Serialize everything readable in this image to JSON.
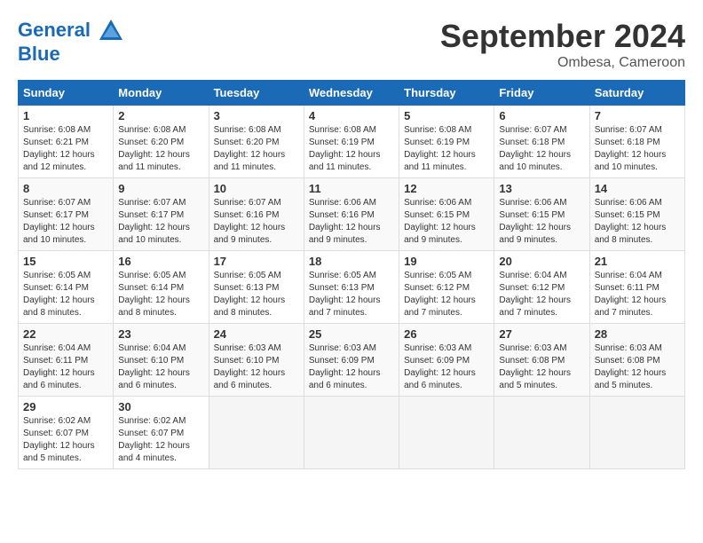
{
  "header": {
    "logo_general": "General",
    "logo_blue": "Blue",
    "month_title": "September 2024",
    "location": "Ombesa, Cameroon"
  },
  "columns": [
    "Sunday",
    "Monday",
    "Tuesday",
    "Wednesday",
    "Thursday",
    "Friday",
    "Saturday"
  ],
  "weeks": [
    [
      {
        "day": "1",
        "info": "Sunrise: 6:08 AM\nSunset: 6:21 PM\nDaylight: 12 hours\nand 12 minutes."
      },
      {
        "day": "2",
        "info": "Sunrise: 6:08 AM\nSunset: 6:20 PM\nDaylight: 12 hours\nand 11 minutes."
      },
      {
        "day": "3",
        "info": "Sunrise: 6:08 AM\nSunset: 6:20 PM\nDaylight: 12 hours\nand 11 minutes."
      },
      {
        "day": "4",
        "info": "Sunrise: 6:08 AM\nSunset: 6:19 PM\nDaylight: 12 hours\nand 11 minutes."
      },
      {
        "day": "5",
        "info": "Sunrise: 6:08 AM\nSunset: 6:19 PM\nDaylight: 12 hours\nand 11 minutes."
      },
      {
        "day": "6",
        "info": "Sunrise: 6:07 AM\nSunset: 6:18 PM\nDaylight: 12 hours\nand 10 minutes."
      },
      {
        "day": "7",
        "info": "Sunrise: 6:07 AM\nSunset: 6:18 PM\nDaylight: 12 hours\nand 10 minutes."
      }
    ],
    [
      {
        "day": "8",
        "info": "Sunrise: 6:07 AM\nSunset: 6:17 PM\nDaylight: 12 hours\nand 10 minutes."
      },
      {
        "day": "9",
        "info": "Sunrise: 6:07 AM\nSunset: 6:17 PM\nDaylight: 12 hours\nand 10 minutes."
      },
      {
        "day": "10",
        "info": "Sunrise: 6:07 AM\nSunset: 6:16 PM\nDaylight: 12 hours\nand 9 minutes."
      },
      {
        "day": "11",
        "info": "Sunrise: 6:06 AM\nSunset: 6:16 PM\nDaylight: 12 hours\nand 9 minutes."
      },
      {
        "day": "12",
        "info": "Sunrise: 6:06 AM\nSunset: 6:15 PM\nDaylight: 12 hours\nand 9 minutes."
      },
      {
        "day": "13",
        "info": "Sunrise: 6:06 AM\nSunset: 6:15 PM\nDaylight: 12 hours\nand 9 minutes."
      },
      {
        "day": "14",
        "info": "Sunrise: 6:06 AM\nSunset: 6:15 PM\nDaylight: 12 hours\nand 8 minutes."
      }
    ],
    [
      {
        "day": "15",
        "info": "Sunrise: 6:05 AM\nSunset: 6:14 PM\nDaylight: 12 hours\nand 8 minutes."
      },
      {
        "day": "16",
        "info": "Sunrise: 6:05 AM\nSunset: 6:14 PM\nDaylight: 12 hours\nand 8 minutes."
      },
      {
        "day": "17",
        "info": "Sunrise: 6:05 AM\nSunset: 6:13 PM\nDaylight: 12 hours\nand 8 minutes."
      },
      {
        "day": "18",
        "info": "Sunrise: 6:05 AM\nSunset: 6:13 PM\nDaylight: 12 hours\nand 7 minutes."
      },
      {
        "day": "19",
        "info": "Sunrise: 6:05 AM\nSunset: 6:12 PM\nDaylight: 12 hours\nand 7 minutes."
      },
      {
        "day": "20",
        "info": "Sunrise: 6:04 AM\nSunset: 6:12 PM\nDaylight: 12 hours\nand 7 minutes."
      },
      {
        "day": "21",
        "info": "Sunrise: 6:04 AM\nSunset: 6:11 PM\nDaylight: 12 hours\nand 7 minutes."
      }
    ],
    [
      {
        "day": "22",
        "info": "Sunrise: 6:04 AM\nSunset: 6:11 PM\nDaylight: 12 hours\nand 6 minutes."
      },
      {
        "day": "23",
        "info": "Sunrise: 6:04 AM\nSunset: 6:10 PM\nDaylight: 12 hours\nand 6 minutes."
      },
      {
        "day": "24",
        "info": "Sunrise: 6:03 AM\nSunset: 6:10 PM\nDaylight: 12 hours\nand 6 minutes."
      },
      {
        "day": "25",
        "info": "Sunrise: 6:03 AM\nSunset: 6:09 PM\nDaylight: 12 hours\nand 6 minutes."
      },
      {
        "day": "26",
        "info": "Sunrise: 6:03 AM\nSunset: 6:09 PM\nDaylight: 12 hours\nand 6 minutes."
      },
      {
        "day": "27",
        "info": "Sunrise: 6:03 AM\nSunset: 6:08 PM\nDaylight: 12 hours\nand 5 minutes."
      },
      {
        "day": "28",
        "info": "Sunrise: 6:03 AM\nSunset: 6:08 PM\nDaylight: 12 hours\nand 5 minutes."
      }
    ],
    [
      {
        "day": "29",
        "info": "Sunrise: 6:02 AM\nSunset: 6:07 PM\nDaylight: 12 hours\nand 5 minutes."
      },
      {
        "day": "30",
        "info": "Sunrise: 6:02 AM\nSunset: 6:07 PM\nDaylight: 12 hours\nand 4 minutes."
      },
      {
        "day": "",
        "info": ""
      },
      {
        "day": "",
        "info": ""
      },
      {
        "day": "",
        "info": ""
      },
      {
        "day": "",
        "info": ""
      },
      {
        "day": "",
        "info": ""
      }
    ]
  ]
}
